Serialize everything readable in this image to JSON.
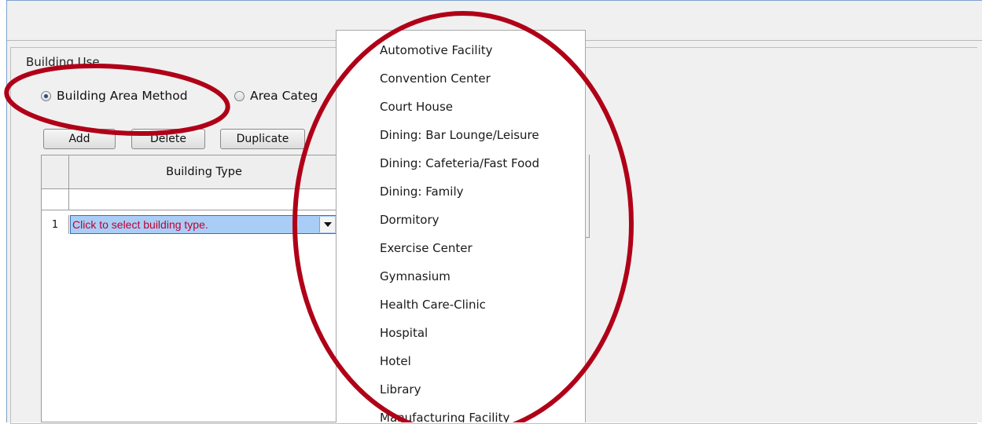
{
  "building_use": {
    "group_title": "Building Use",
    "radio_building_area": {
      "label": "Building Area Method",
      "selected": true
    },
    "radio_area_category": {
      "label": "Area Categ",
      "selected": false
    }
  },
  "toolbar": {
    "add_label": "Add",
    "delete_label": "Delete",
    "duplicate_label": "Duplicate"
  },
  "table": {
    "column_header": "Building Type",
    "rows": [
      {
        "number": "1",
        "building_type": "Click to select building type."
      }
    ]
  },
  "dropdown": {
    "items": [
      "Automotive Facility",
      "Convention Center",
      "Court House",
      "Dining: Bar Lounge/Leisure",
      "Dining: Cafeteria/Fast Food",
      "Dining: Family",
      "Dormitory",
      "Exercise Center",
      "Gymnasium",
      "Health Care-Clinic",
      "Hospital",
      "Hotel",
      "Library",
      "Manufacturing Facility"
    ]
  },
  "colors": {
    "annotation": "#b00018",
    "selected_cell": "#a9cdf5",
    "placeholder_text": "#c00030"
  }
}
